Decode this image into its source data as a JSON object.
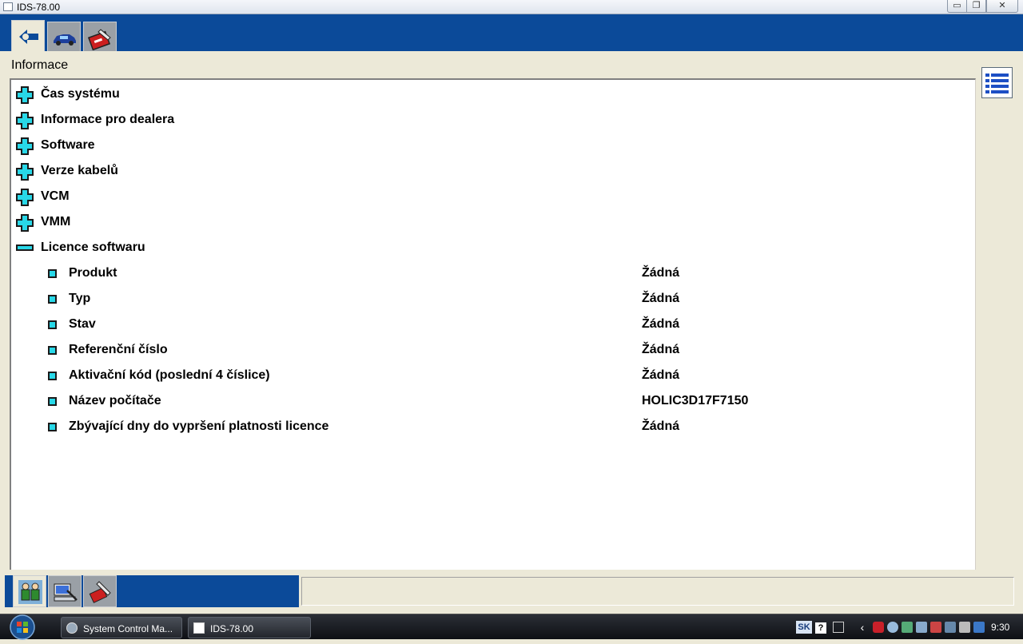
{
  "window": {
    "title": "IDS-78.00",
    "minimize_glyph": "▭",
    "maximize_glyph": "❐",
    "close_glyph": "✕"
  },
  "toolbar": {
    "tabs": [
      {
        "icon": "back-arrow-icon",
        "active": true
      },
      {
        "icon": "car-icon",
        "active": false
      },
      {
        "icon": "toolbox-icon",
        "active": false
      }
    ]
  },
  "section_title": "Informace",
  "tree": {
    "collapsed_groups": [
      "Čas systému",
      "Informace pro dealera",
      "Software",
      "Verze kabelů",
      "VCM",
      "VMM"
    ],
    "expanded_group": "Licence softwaru",
    "items": [
      {
        "label": "Produkt",
        "value": "Žádná"
      },
      {
        "label": "Typ",
        "value": "Žádná"
      },
      {
        "label": "Stav",
        "value": "Žádná"
      },
      {
        "label": "Referenční číslo",
        "value": "Žádná"
      },
      {
        "label": "Aktivační kód (poslední 4 číslice)",
        "value": "Žádná"
      },
      {
        "label": "Název počítače",
        "value": "HOLIC3D17F7150"
      },
      {
        "label": "Zbývající dny do vypršení platnosti licence",
        "value": "Žádná"
      }
    ]
  },
  "bottom_tabs": [
    {
      "icon": "people-icon",
      "active": true
    },
    {
      "icon": "computer-tools-icon",
      "active": false
    },
    {
      "icon": "tools-icon",
      "active": false
    }
  ],
  "taskbar": {
    "buttons": [
      {
        "label": "System Control Ma..."
      },
      {
        "label": "IDS-78.00"
      }
    ],
    "language": "SK",
    "help_glyph": "?",
    "chevron_glyph": "‹",
    "clock": "9:30"
  },
  "colors": {
    "header_blue": "#0b4a99",
    "accent_cyan": "#28d8e8"
  }
}
